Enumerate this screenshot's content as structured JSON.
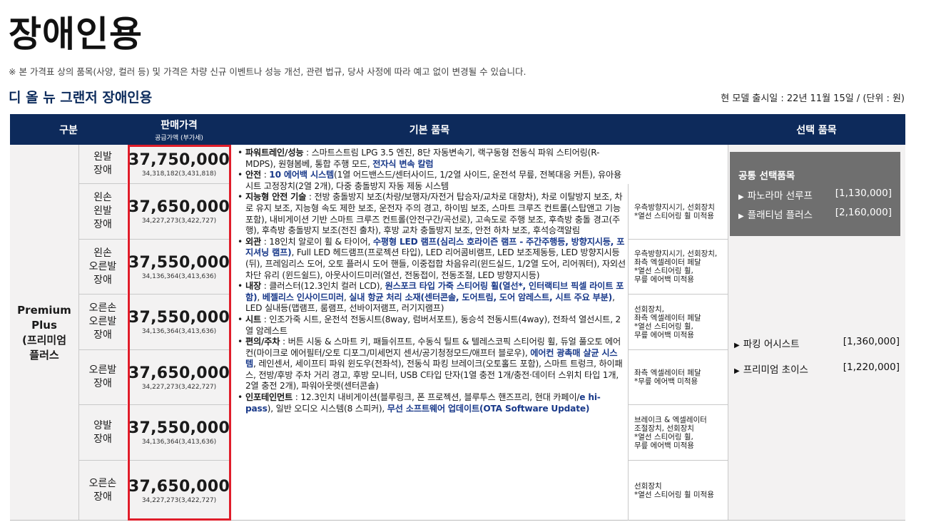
{
  "title": "장애인용",
  "notice": "※ 본 가격표 상의 품목(사양, 컬러 등) 및 가격은 차량 신규 이벤트나 성능 개선, 관련 법규, 당사 사정에 따라 예고 없이 변경될 수 있습니다.",
  "subtitle": "디 올 뉴 그랜저 장애인용",
  "release_info": "현 모델 출시일 : 22년 11월 15일  /  (단위 : 원)",
  "table": {
    "headers": {
      "category": "구분",
      "price": "판매가격",
      "price_sub": "공급가액 (부가세)",
      "basic": "기본 품목",
      "option": "선택 품목"
    },
    "grade": "Premium\nPlus\n(프리미엄\n플러스",
    "rows": [
      {
        "type": "왼발\n장애",
        "price": "37,750,000",
        "supply": "34,318,182(3,431,818)",
        "option": ""
      },
      {
        "type": "왼손\n왼발\n장애",
        "price": "37,650,000",
        "supply": "34,227,273(3,422,727)",
        "option": "우측방향지시기, 선회장치\n*열선 스티어링 휠 미적용"
      },
      {
        "type": "왼손\n오른발\n장애",
        "price": "37,550,000",
        "supply": "34,136,364(3,413,636)",
        "option": "우측방향지시기, 선회장치,\n좌측 엑셀레이터 페달\n*열선 스티어링 휠,\n 무릎 에어백 미적용"
      },
      {
        "type": "오른손\n오른발\n장애",
        "price": "37,550,000",
        "supply": "34,136,364(3,413,636)",
        "option": "선회장치,\n좌측 엑셀레이터 페달\n*열선 스티어링 휠,\n 무릎 에어백 미적용"
      },
      {
        "type": "오른발\n장애",
        "price": "37,650,000",
        "supply": "34,227,273(3,422,727)",
        "option": "좌측 엑셀레이터 페달\n*무릎 에어백 미적용"
      },
      {
        "type": "양발\n장애",
        "price": "37,550,000",
        "supply": "34,136,364(3,413,636)",
        "option": "브레이크 & 엑셀레이터\n조절장치, 선회장치\n*열선 스티어링 휠,\n 무릎 에어백 미적용"
      },
      {
        "type": "오른손\n장애",
        "price": "37,650,000",
        "supply": "34,227,273(3,422,727)",
        "option": "선회장치\n*열선 스티어링 휠 미적용"
      }
    ],
    "basic_items": {
      "powertrain_label": "파워트레인/성능",
      "powertrain_text": " : 스마트스트림 LPG 3.5 엔진, 8단 자동변속기, 랙구동형 전동식 파워 스티어링(R-MDPS), 원형봄베, 통합 주행 모드, ",
      "powertrain_hl": "전자식 변속 칼럼",
      "safety_label": "안전",
      "safety_pre": " : ",
      "safety_hl": "10 에어백 시스템",
      "safety_text": "(1열 어드밴스드/센터사이드, 1/2열 사이드, 운전석 무릎, 전복대응 커튼), 유아용 시트 고정장치(2열 2개), 다중 충돌방지 자동 제동 시스템",
      "adas_label": "지능형 안전 기술",
      "adas_text": " : 전방 충돌방지 보조(차량/보행자/자전거 탑승자/교차로 대향차), 차로 이탈방지 보조, 차로 유지 보조, 지능형 속도 제한 보조, 운전자 주의 경고, 하이빔 보조, 스마트 크루즈 컨트롤(스탑앤고 기능 포함), 내비게이션 기반 스마트 크루즈 컨트롤(안전구간/곡선로), 고속도로 주행 보조, 후측방 충돌 경고(주행), 후측방 충돌방지 보조(전진 출차), 후방 교차 충돌방지 보조, 안전 하차 보조, 후석승객알림",
      "ext_label": "외관",
      "ext_pre": " : 18인치 알로이 휠 & 타이어, ",
      "ext_hl1": "수평형 LED 램프(심리스 호라이즌 램프 - 주간주행등, 방향지시등, 포지셔닝 램프)",
      "ext_text": ", Full LED 헤드램프(프로젝션 타입), LED 리어콤비램프, LED 보조제동등, LED 방향지시등(뒤), 프레임리스 도어, 오토 플러시 도어 핸들, 이중접합 차음유리(윈드실드, 1/2열 도어, 리어쿼터), 자외선 차단 유리 (윈드쉴드), 아웃사이드미러(열선, 전동접이, 전동조절, LED 방향지시등)",
      "int_label": "내장",
      "int_pre": " : 클러스터(12.3인치 컬러 LCD), ",
      "int_hl1": "원스포크 타입 가죽 스티어링 휠(열선*, 인터랙티브 픽셀 라이트 포함)",
      "int_sep1": ", ",
      "int_hl2": "베젤리스 인사이드미러",
      "int_sep2": ", ",
      "int_hl3": "실내 항균 처리 소재(센터콘솔, 도어트림, 도어 암레스트, 시트 주요 부분)",
      "int_text": ", LED 실내등(맵램프, 룸램프, 선바이저램프, 러기지램프)",
      "seat_label": "시트",
      "seat_text": " : 인조가죽 시트, 운전석 전동시트(8way, 럼버서포트), 동승석 전동시트(4way), 전좌석 열선시트, 2열 암레스트",
      "conv_label": "편의/주차",
      "conv_pre": " : 버튼 시동 & 스마트 키, 패들쉬프트, 수동식 틸트 & 텔레스코픽 스티어링 휠, 듀얼 풀오토 에어컨(마이크로 에어필터/오토 디포그/미세먼지 센서/공기청정모드/애프터 블로우), ",
      "conv_hl": "에어컨 광촉매 살균 시스템",
      "conv_text": ", 레인센서, 세이프티 파워 윈도우(전좌석), 전동식 파킹 브레이크(오토홀드 포함), 스마트 트렁크, 하이패스, 전방/후방 주차 거리 경고, 후방 모니터, USB C타입 단자(1열 충전 1개/충전·데이터 스위치 타입 1개, 2열 충전 2개), 파워아웃렛(센터콘솔)",
      "info_label": "인포테인먼트",
      "info_pre": " : 12.3인치 내비게이션(블루링크, 폰 프로젝션, 블루투스 핸즈프리, 현대 카페이/",
      "info_hl1": "e hi-pass",
      "info_text": "), 일반 오디오 시스템(8 스피커), ",
      "info_hl2": "무선 소프트웨어 업데이트(OTA Software Update)"
    },
    "common_options": {
      "title": "공통 선택품목",
      "items": [
        {
          "name": "파노라마 선루프",
          "price": "[1,130,000]"
        },
        {
          "name": "플래티넘 플러스",
          "price": "[2,160,000]"
        }
      ]
    },
    "extra_options": [
      {
        "name": "파킹 어시스트",
        "price": "[1,360,000]"
      },
      {
        "name": "프리미엄 초이스",
        "price": "[1,220,000]"
      }
    ]
  },
  "colors": {
    "header_bg": "#0d2a5b",
    "highlight_text": "#1a3a8a",
    "red_frame": "#e01d2a",
    "common_box_bg": "#6f6f6f"
  }
}
